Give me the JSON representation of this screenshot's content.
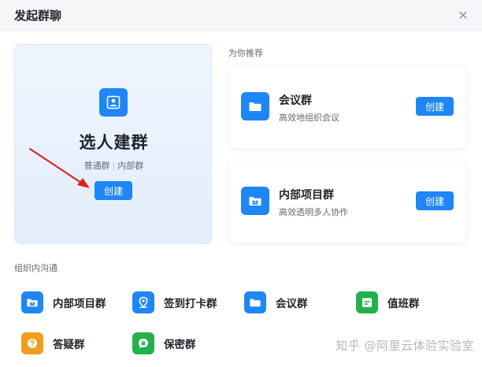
{
  "dialog": {
    "title": "发起群聊",
    "close_symbol": "✕"
  },
  "hero": {
    "icon": "user-icon",
    "title": "选人建群",
    "tag_a": "普通群",
    "tag_sep": "|",
    "tag_b": "内部群",
    "button": "创建"
  },
  "recommend": {
    "label": "为你推荐",
    "items": [
      {
        "name": "会议群",
        "desc": "高效地组织会议",
        "button": "创建",
        "icon": "folder-icon"
      },
      {
        "name": "内部项目群",
        "desc": "高效透明多人协作",
        "button": "创建",
        "icon": "project-folder-icon"
      }
    ]
  },
  "org": {
    "label": "组织内沟通",
    "items": [
      {
        "name": "内部项目群",
        "icon": "project-folder-icon",
        "color": "#1f86f5"
      },
      {
        "name": "签到打卡群",
        "icon": "location-icon",
        "color": "#1f86f5"
      },
      {
        "name": "会议群",
        "icon": "folder-icon",
        "color": "#1f86f5"
      },
      {
        "name": "值班群",
        "icon": "calendar-icon",
        "color": "#23b14d"
      },
      {
        "name": "答疑群",
        "icon": "question-icon",
        "color": "#f29d1f"
      },
      {
        "name": "保密群",
        "icon": "secret-chat-icon",
        "color": "#23b14d"
      }
    ]
  },
  "watermark": "知乎 @阿里云体验实验室",
  "colors": {
    "accent": "#1f86f5",
    "green": "#23b14d",
    "orange": "#f29d1f",
    "arrow": "#e02020"
  }
}
